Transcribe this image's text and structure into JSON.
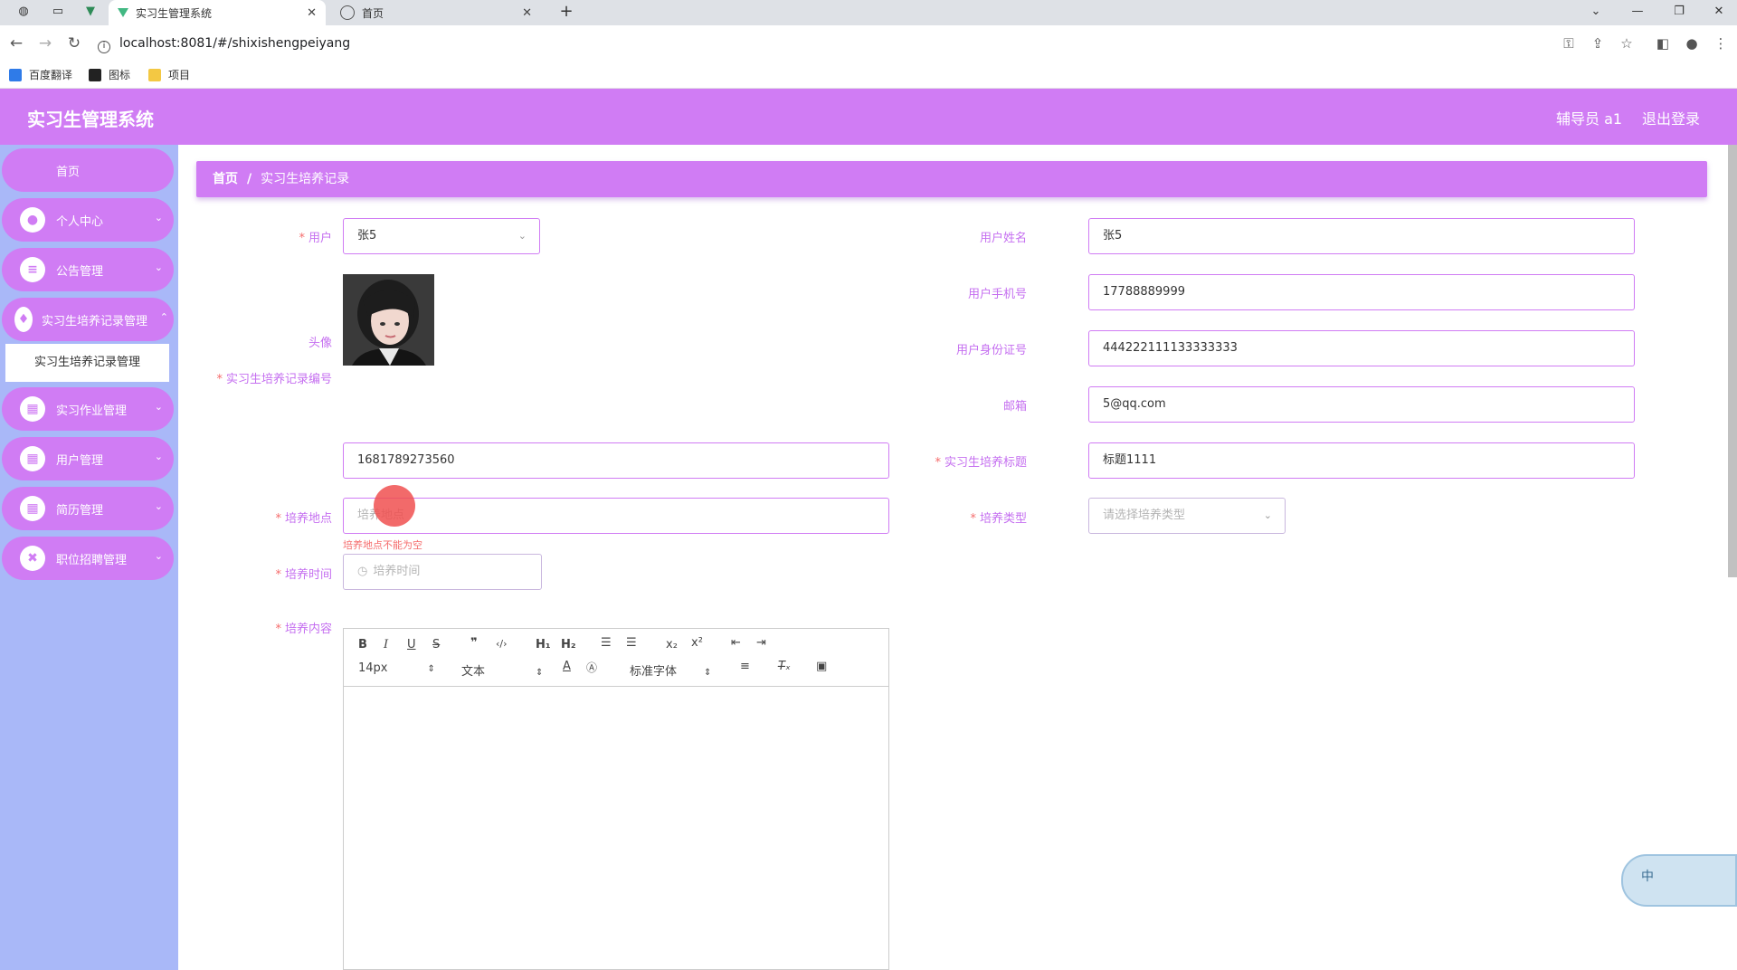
{
  "browser": {
    "tabs": [
      {
        "title": "实习生管理系统",
        "active": true
      },
      {
        "title": "首页",
        "active": false
      }
    ],
    "url": "localhost:8081/#/shixishengpeiyang",
    "bookmarks": [
      "百度翻译",
      "图标",
      "项目"
    ]
  },
  "header": {
    "title": "实习生管理系统",
    "user": "辅导员 a1",
    "logout": "退出登录"
  },
  "sidebar": {
    "home": "首页",
    "items": [
      {
        "label": "个人中心",
        "icon": "user-icon"
      },
      {
        "label": "公告管理",
        "icon": "list-icon"
      },
      {
        "label": "实习生培养记录管理",
        "icon": "bulb-icon"
      },
      {
        "label": "实习作业管理",
        "icon": "grid-icon"
      },
      {
        "label": "用户管理",
        "icon": "grid-icon"
      },
      {
        "label": "简历管理",
        "icon": "grid-icon"
      },
      {
        "label": "职位招聘管理",
        "icon": "briefcase-icon"
      }
    ],
    "submenu": "实习生培养记录管理"
  },
  "breadcrumb": {
    "home": "首页",
    "separator": "/",
    "current": "实习生培养记录"
  },
  "form": {
    "user_label": "用户",
    "user_value": "张5",
    "avatar_label": "头像",
    "name_label": "用户姓名",
    "name_value": "张5",
    "phone_label": "用户手机号",
    "phone_value": "17788889999",
    "idcard_label": "用户身份证号",
    "idcard_value": "444222111133333333",
    "email_label": "邮箱",
    "email_value": "5@qq.com",
    "record_no_label": "实习生培养记录编号",
    "record_no_value": "1681789273560",
    "title_label": "实习生培养标题",
    "title_value": "标题1111",
    "place_label": "培养地点",
    "place_placeholder": "培养地点",
    "place_error": "培养地点不能为空",
    "type_label": "培养类型",
    "type_placeholder": "请选择培养类型",
    "time_label": "培养时间",
    "time_placeholder": "培养时间",
    "content_label": "培养内容"
  },
  "editor": {
    "font_size": "14px",
    "paragraph": "文本",
    "font_family": "标准字体"
  },
  "widget": {
    "text": "中"
  },
  "colors": {
    "primary": "#d07cf4",
    "sidebar_bg": "#a9b8f8",
    "error": "#f56c6c"
  }
}
